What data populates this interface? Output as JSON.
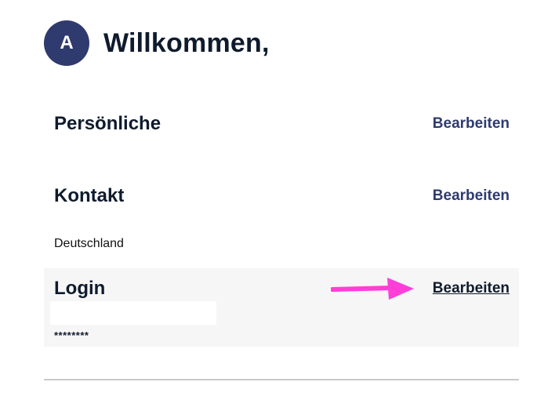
{
  "header": {
    "avatar_initial": "A",
    "welcome": "Willkommen,"
  },
  "sections": {
    "personal": {
      "title": "Persönliche",
      "edit_label": "Bearbeiten"
    },
    "contact": {
      "title": "Kontakt",
      "edit_label": "Bearbeiten",
      "country": "Deutschland"
    },
    "login": {
      "title": "Login",
      "edit_label": "Bearbeiten",
      "password": "********"
    }
  },
  "icons": {
    "annotation_arrow": "arrow-right-icon"
  },
  "colors": {
    "accent": "#2f3a6e",
    "annotation": "#ff3ed8",
    "panel_bg": "#f6f6f6"
  }
}
